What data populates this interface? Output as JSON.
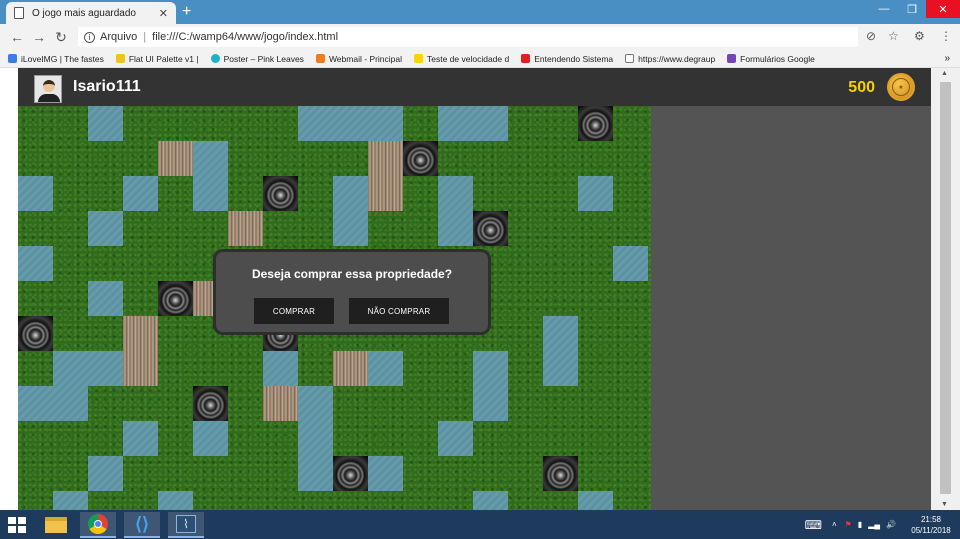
{
  "browser": {
    "tab_title": "O jogo mais aguardado",
    "new_tab": "+",
    "address_prefix": "Arquivo",
    "url": "file:///C:/wamp64/www/jogo/index.html",
    "window_controls": [
      "—",
      "❐",
      "✕"
    ]
  },
  "bookmarks": [
    {
      "label": "iLoveIMG | The fastes",
      "color": "#3d7ee6"
    },
    {
      "label": "Flat UI Palette v1 |",
      "color": "#f0c419"
    },
    {
      "label": "Poster – Pink Leaves",
      "color": "#1ab3c6"
    },
    {
      "label": "Webmail - Principal",
      "color": "#f07c1e"
    },
    {
      "label": "Teste de velocidade d",
      "color": "#ffd200"
    },
    {
      "label": "Entendendo Sistema",
      "color": "#e02020"
    },
    {
      "label": "https://www.degraup",
      "color": "#cccccc"
    },
    {
      "label": "Formulários Google",
      "color": "#7248b9"
    }
  ],
  "game": {
    "username": "Isario111",
    "coins": "500",
    "modal": {
      "question": "Deseja comprar essa propriedade?",
      "buy_label": "COMPRAR",
      "dont_buy_label": "NÃO COMPRAR"
    },
    "colors": {
      "grass": "#2f6a1d",
      "water": "#5b93a2",
      "coin_text": "#f5d100",
      "header": "#333333",
      "panel": "#545454"
    }
  },
  "taskbar": {
    "time": "21:58",
    "date": "05/11/2018"
  }
}
